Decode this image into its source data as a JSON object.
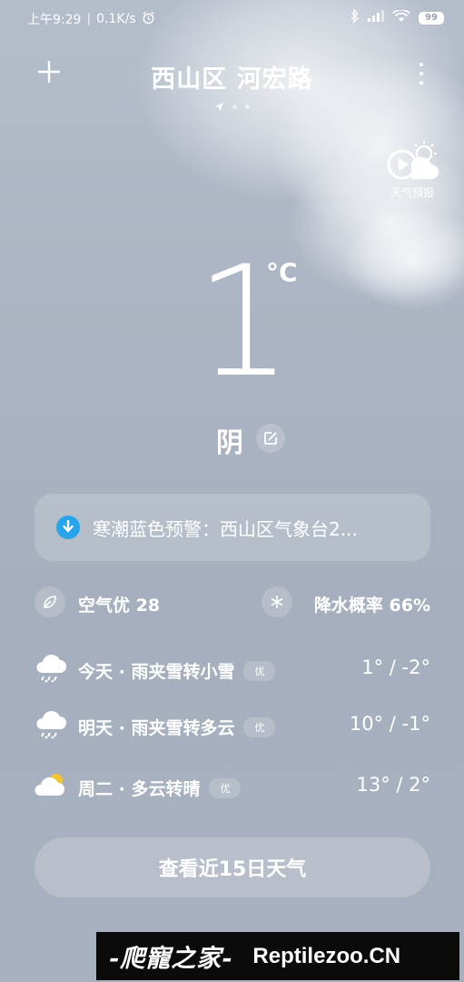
{
  "status_bar": {
    "time": "上午9:29",
    "net_speed": "0.1K/s",
    "battery": "99"
  },
  "header": {
    "add_icon": "plus-icon",
    "location": "西山区 河宏路",
    "more_icon": "more-vertical-icon",
    "pager_icon": "location-arrow-icon"
  },
  "forecast_video": {
    "label": "天气预报",
    "icon": "play-weather-icon"
  },
  "current": {
    "temperature": "1",
    "unit": "°C",
    "condition": "阴"
  },
  "alert": {
    "icon": "warning-down-icon",
    "text": "寒潮蓝色预警：西山区气象台2..."
  },
  "air": {
    "aqi_label": "空气优 28",
    "aqi_icon": "leaf-icon",
    "precip_label": "降水概率 66%",
    "precip_icon": "snowflake-icon"
  },
  "forecast": [
    {
      "day_text": "今天 · 雨夹雪转小雪",
      "badge": "优",
      "temp": "1° / -2°",
      "icon": "rain-snow-icon"
    },
    {
      "day_text": "明天 · 雨夹雪转多云",
      "badge": "优",
      "temp": "10° / -1°",
      "icon": "rain-snow-icon"
    },
    {
      "day_text": "周二 · 多云转晴",
      "badge": "优",
      "temp": "13° / 2°",
      "icon": "cloudy-sun-icon"
    }
  ],
  "button_15": "查看近15日天气",
  "watermark": {
    "logo": "-爬寵之家-",
    "site": "Reptilezoo.CN"
  },
  "colors": {
    "sky": "#acb5c3",
    "alert_blue": "#28a5ea"
  }
}
